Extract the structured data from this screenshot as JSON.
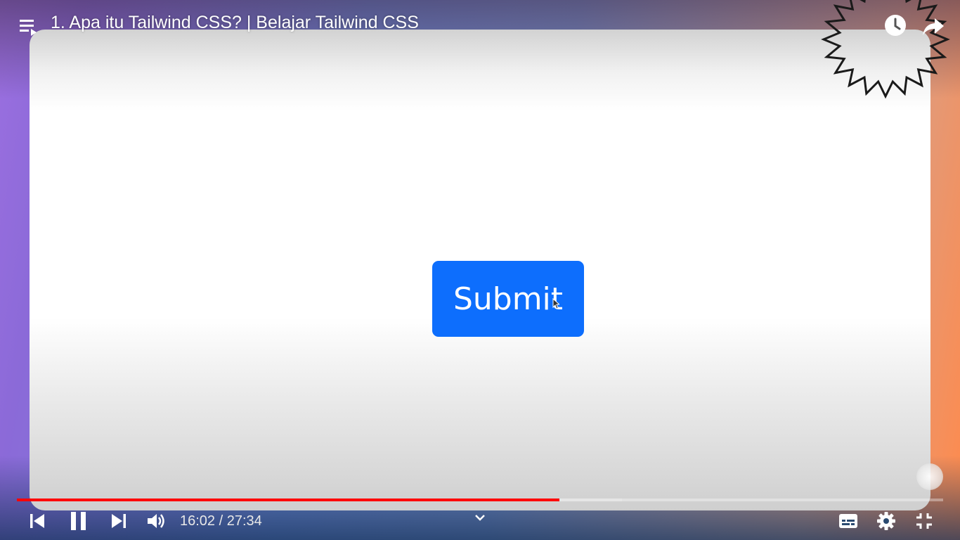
{
  "player": {
    "title": "1. Apa itu Tailwind CSS? | Belajar Tailwind CSS",
    "time_current": "16:02",
    "time_separator": " / ",
    "time_total": "27:34",
    "progress_played": 0.586,
    "progress_buffered": 0.653,
    "accent_color": "#ff0000"
  },
  "video_content": {
    "button_label": "Submit",
    "button_color": "#0d6efd"
  },
  "icons": {
    "playlist": "playlist-icon",
    "watch_later": "clock-icon",
    "share": "share-arrow-icon",
    "previous": "skip-previous-icon",
    "pause": "pause-icon",
    "next": "skip-next-icon",
    "volume": "volume-icon",
    "chapters": "chevron-down-icon",
    "subtitles": "subtitles-icon",
    "settings": "gear-icon",
    "exit_fullscreen": "exit-fullscreen-icon"
  }
}
